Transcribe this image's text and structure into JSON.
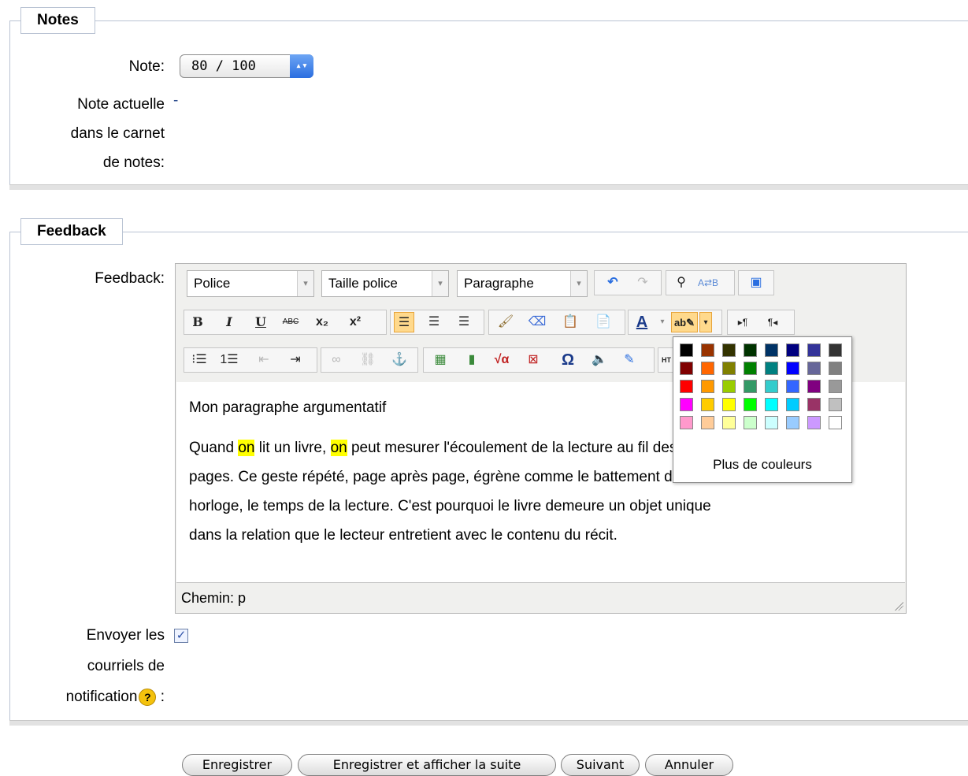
{
  "notes_section": {
    "legend": "Notes",
    "grade_label": "Note:",
    "grade_value": "80 / 100",
    "current_label_1": "Note actuelle",
    "current_label_2": "dans le carnet",
    "current_label_3": "de notes:",
    "current_value": "-"
  },
  "feedback_section": {
    "legend": "Feedback",
    "feedback_label": "Feedback:",
    "editor": {
      "font_combo": "Police",
      "size_combo": "Taille police",
      "format_combo": "Paragraphe",
      "paragraph_1": "Mon paragraphe argumentatif",
      "p2_part1": "Quand ",
      "p2_hl1": "on",
      "p2_part2": " lit un livre, ",
      "p2_hl2": "on",
      "p2_part3": " peut mesurer l'écoulement de la lecture au fil des",
      "p2_line2": "pages. Ce geste répété, page après page, égrène comme le battement d'une",
      "p2_line3": "horloge, le temps de la lecture. C'est pourquoi le livre demeure un objet unique",
      "p2_line4": "dans la relation que le lecteur entretient avec le contenu du récit.",
      "path_label": "Chemin:",
      "path_value": "p"
    },
    "color_picker": {
      "more_colors": "Plus de couleurs",
      "colors": [
        [
          "#000000",
          "#993300",
          "#333300",
          "#003300",
          "#003366",
          "#000080",
          "#333399",
          "#333333"
        ],
        [
          "#800000",
          "#ff6600",
          "#808000",
          "#008000",
          "#008080",
          "#0000ff",
          "#666699",
          "#808080"
        ],
        [
          "#ff0000",
          "#ff9900",
          "#99cc00",
          "#339966",
          "#33cccc",
          "#3366ff",
          "#800080",
          "#999999"
        ],
        [
          "#ff00ff",
          "#ffcc00",
          "#ffff00",
          "#00ff00",
          "#00ffff",
          "#00ccff",
          "#993366",
          "#c0c0c0"
        ],
        [
          "#ff99cc",
          "#ffcc99",
          "#ffff99",
          "#ccffcc",
          "#ccffff",
          "#99ccff",
          "#cc99ff",
          "#ffffff"
        ]
      ]
    },
    "notify_label_1": "Envoyer les",
    "notify_label_2": "courriels de",
    "notify_label_3": "notification",
    "notify_colon": " :",
    "help_glyph": "?",
    "notify_checked": true
  },
  "buttons": {
    "save": "Enregistrer",
    "save_next": "Enregistrer et afficher la suite",
    "next": "Suivant",
    "cancel": "Annuler"
  }
}
